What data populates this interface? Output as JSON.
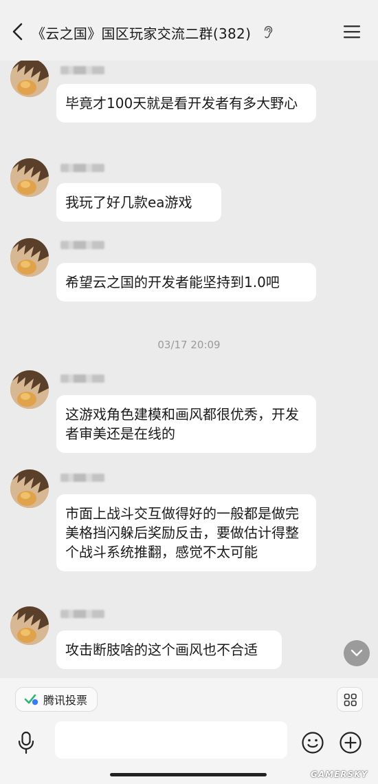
{
  "header": {
    "title": "《云之国》国区玩家交流二群(382)",
    "back_icon": "chevron-left-icon",
    "ear_icon": "ear-icon",
    "menu_icon": "hamburger-menu-icon"
  },
  "messages": [
    {
      "text": "毕竟才100天就是看开发者有多大野心"
    },
    {
      "text": "我玩了好几款ea游戏"
    },
    {
      "text": "希望云之国的开发者能坚持到1.0吧"
    },
    {
      "text": "这游戏角色建模和画风都很优秀，开发者审美还是在线的"
    },
    {
      "text": "市面上战斗交互做得好的一般都是做完美格挡闪躲后奖励反击，要做估计得整个战斗系统推翻，感觉不太可能"
    },
    {
      "text": "攻击断肢啥的这个画风也不合适"
    }
  ],
  "timestamp": "03/17 20:09",
  "toolbar": {
    "vote_label": "腾讯投票",
    "input_value": "",
    "icons": [
      "mic-icon",
      "emoji-icon",
      "plus-icon",
      "apps-grid-icon"
    ]
  },
  "watermark": "GAMERSKY",
  "colors": {
    "background": "#ebebeb",
    "bubble": "#ffffff",
    "vote_icon_green": "#2bb673",
    "vote_icon_blue": "#3b7bf6"
  }
}
